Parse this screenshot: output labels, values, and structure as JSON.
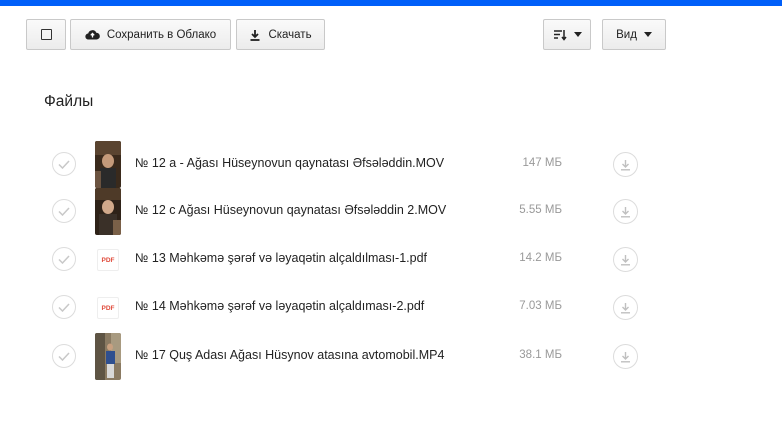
{
  "toolbar": {
    "save_label": "Сохранить в Облако",
    "download_label": "Скачать",
    "view_label": "Вид"
  },
  "section_title": "Файлы",
  "files": [
    {
      "name": "№ 12 a - Ağası Hüseynovun qaynatası Əfsələddin.MOV",
      "size": "147 МБ",
      "type": "video"
    },
    {
      "name": "№ 12 c Ağası Hüseynovun qaynatası Əfsələddin 2.MOV",
      "size": "5.55 МБ",
      "type": "video"
    },
    {
      "name": "№ 13 Məhkəmə şərəf və ləyaqətin alçaldılması-1.pdf",
      "size": "14.2 МБ",
      "type": "pdf"
    },
    {
      "name": "№ 14 Məhkəmə şərəf və ləyaqətin alçaldıması-2.pdf",
      "size": "7.03 МБ",
      "type": "pdf"
    },
    {
      "name": "№ 17 Quş Adası Ağası Hüsynov atasına avtomobil.MP4",
      "size": "38.1 МБ",
      "type": "video"
    }
  ],
  "pdf_badge": "PDF",
  "colors": {
    "accent": "#005ff9",
    "pdf": "#e04a3a"
  },
  "icons": [
    "checkbox-icon",
    "cloud-icon",
    "download-icon",
    "sort-icon",
    "chevron-down-icon",
    "check-icon"
  ]
}
